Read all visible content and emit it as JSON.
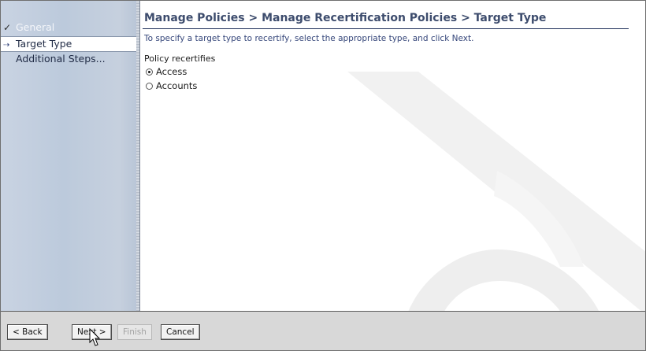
{
  "nav": {
    "items": [
      {
        "icon": "check-icon",
        "glyph": "✓",
        "label": "General",
        "state": "completed"
      },
      {
        "icon": "arrow-icon",
        "glyph": "⇢",
        "label": "Target Type",
        "state": "current"
      },
      {
        "icon": "",
        "glyph": "",
        "label": "Additional Steps...",
        "state": "pending"
      }
    ]
  },
  "main": {
    "title": "Manage Policies > Manage Recertification Policies > Target Type",
    "instructions": "To specify a target type to recertify, select the appropriate type, and click Next.",
    "group_label": "Policy recertifies",
    "options": [
      {
        "label": "Access",
        "checked": true
      },
      {
        "label": "Accounts",
        "checked": false
      }
    ]
  },
  "buttons": {
    "back": "< Back",
    "next": "Next >",
    "finish": "Finish",
    "cancel": "Cancel"
  },
  "colors": {
    "title": "#3d4c6d",
    "instructions": "#35467a",
    "nav_background": "#bccadc",
    "selected_nav": "#ffffff",
    "button_bar": "#d8d8d8"
  }
}
